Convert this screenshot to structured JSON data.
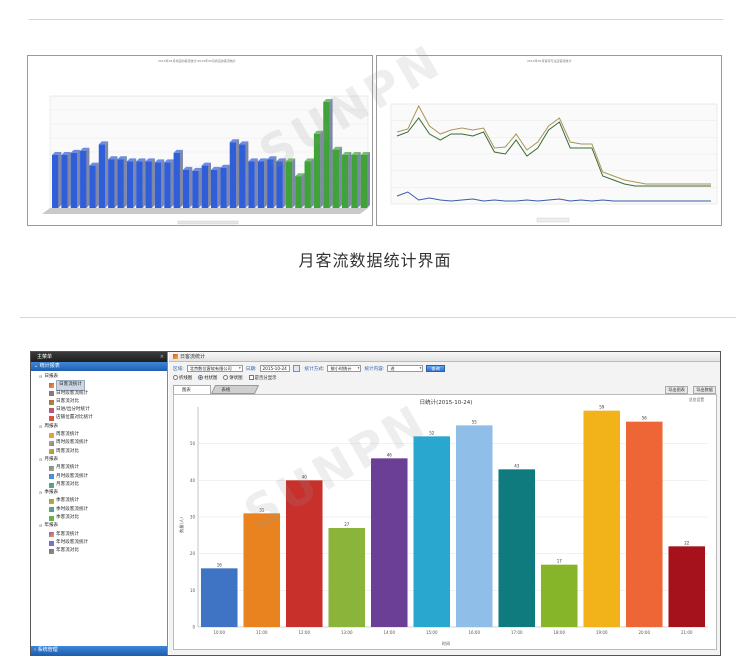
{
  "caption": "月客流数据统计界面",
  "top_left_chart": {
    "title": "2015年05月商店的客流统计/2015年05月商店的客流统计",
    "bars": [
      50,
      50,
      52,
      54,
      40,
      60,
      46,
      46,
      44,
      44,
      44,
      43,
      43,
      52,
      36,
      35,
      40,
      36,
      38,
      62,
      60,
      44,
      44,
      46,
      44,
      44,
      30,
      44,
      70,
      100,
      55,
      50,
      50,
      50
    ],
    "colors": [
      "#2f5ed8",
      "#3fa33a"
    ]
  },
  "top_right_chart": {
    "title": "2015年05月客流与过店客流统计",
    "line_a": [
      72,
      75,
      98,
      78,
      70,
      74,
      76,
      74,
      76,
      56,
      57,
      70,
      54,
      62,
      78,
      86,
      62,
      60,
      60,
      32,
      28,
      24,
      22,
      20,
      20,
      20,
      20,
      20,
      20,
      20
    ],
    "line_b": [
      68,
      72,
      86,
      70,
      64,
      70,
      70,
      68,
      72,
      52,
      50,
      64,
      48,
      56,
      74,
      82,
      56,
      56,
      56,
      28,
      24,
      20,
      18,
      18,
      18,
      18,
      18,
      18,
      18,
      18
    ],
    "line_c": [
      8,
      12,
      4,
      6,
      4,
      3,
      4,
      5,
      3,
      4,
      3,
      3,
      4,
      3,
      4,
      5,
      3,
      4,
      3,
      4,
      3,
      3,
      3,
      3,
      3,
      3,
      3,
      3,
      3,
      3
    ]
  },
  "app": {
    "sidebar": {
      "title": "主菜单",
      "close_glyph": "×",
      "section": "统计报表",
      "bottom_section": "系统管理",
      "groups": [
        {
          "label": "日报表",
          "items": [
            "日客流统计",
            "日时段客流统计",
            "日客流对比",
            "日进/出分时统计",
            "店铺位置对比统计"
          ]
        },
        {
          "label": "周报表",
          "items": [
            "周客流统计",
            "周时段客流统计",
            "周客流对比"
          ]
        },
        {
          "label": "月报表",
          "items": [
            "月客流统计",
            "月时段客流统计",
            "月客流对比"
          ]
        },
        {
          "label": "季报表",
          "items": [
            "季客流统计",
            "季时段客流统计",
            "季客流对比"
          ]
        },
        {
          "label": "年报表",
          "items": [
            "年客流统计",
            "年时段客流统计",
            "年客流对比"
          ]
        }
      ]
    },
    "window_title": "日客流统计",
    "toolbar": {
      "org_label": "区域:",
      "org_value": "北京数位客软有限公司",
      "date_label": "日期:",
      "date_value": "2015-10-24",
      "mode_label": "统计方式:",
      "mode_value": "按小时统计",
      "content_label": "统计内容:",
      "content_value": "进",
      "query_button": "查询",
      "radios": [
        "折线图",
        "柱状图",
        "饼状图"
      ],
      "checkbox": "是否分显示"
    },
    "tabs": [
      "图表",
      "表格"
    ],
    "export_buttons": [
      "导出图表",
      "导出数据"
    ],
    "main_chart": {
      "type": "bar",
      "title": "日统计(2015-10-24)",
      "toolbox": "总览设置",
      "xlabel": "时间",
      "ylabel": "数量(人)",
      "categories": [
        "10:00",
        "11:00",
        "12:00",
        "13:00",
        "14:00",
        "15:00",
        "16:00",
        "17:00",
        "18:00",
        "19:00",
        "20:00",
        "21:00"
      ],
      "values": [
        16,
        31,
        40,
        27,
        46,
        52,
        55,
        43,
        17,
        59,
        56,
        22
      ],
      "ylim": [
        0,
        60
      ],
      "yticks": [
        0,
        10,
        20,
        30,
        40,
        50
      ],
      "colors": [
        "#3f74c4",
        "#e8831f",
        "#c8302c",
        "#8ab53a",
        "#6c3f97",
        "#2aa7cf",
        "#8fbfe8",
        "#0f7b7e",
        "#86b52a",
        "#f2b21a",
        "#ee6536",
        "#a5121c"
      ]
    }
  }
}
